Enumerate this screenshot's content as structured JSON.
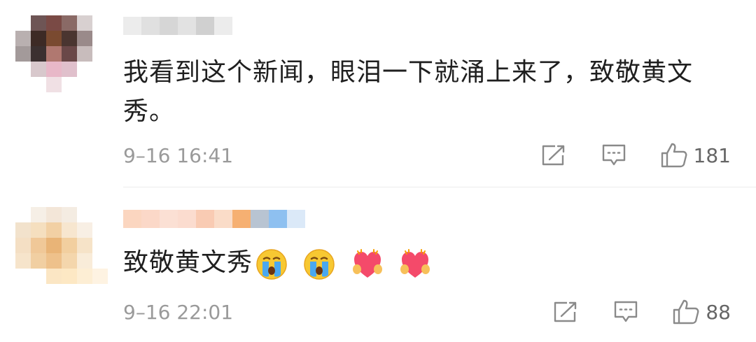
{
  "comments": [
    {
      "username": "",
      "text": "我看到这个新闻，眼泪一下就涌上来了，致敬黄文秀。",
      "emojis": [],
      "time": "9–16 16:41",
      "likes": "181"
    },
    {
      "username": "",
      "text": "致敬黄文秀",
      "emojis": [
        "crying-face",
        "crying-face",
        "heart-hands",
        "heart-hands"
      ],
      "time": "9–16 22:01",
      "likes": "88"
    }
  ],
  "icons": {
    "share": "share-icon",
    "reply": "comment-icon",
    "like": "thumbs-up-icon"
  },
  "colors": {
    "text": "#1f1f1f",
    "meta": "#9a9a9a",
    "icon": "#8a8a8a",
    "divider": "#ececec"
  }
}
